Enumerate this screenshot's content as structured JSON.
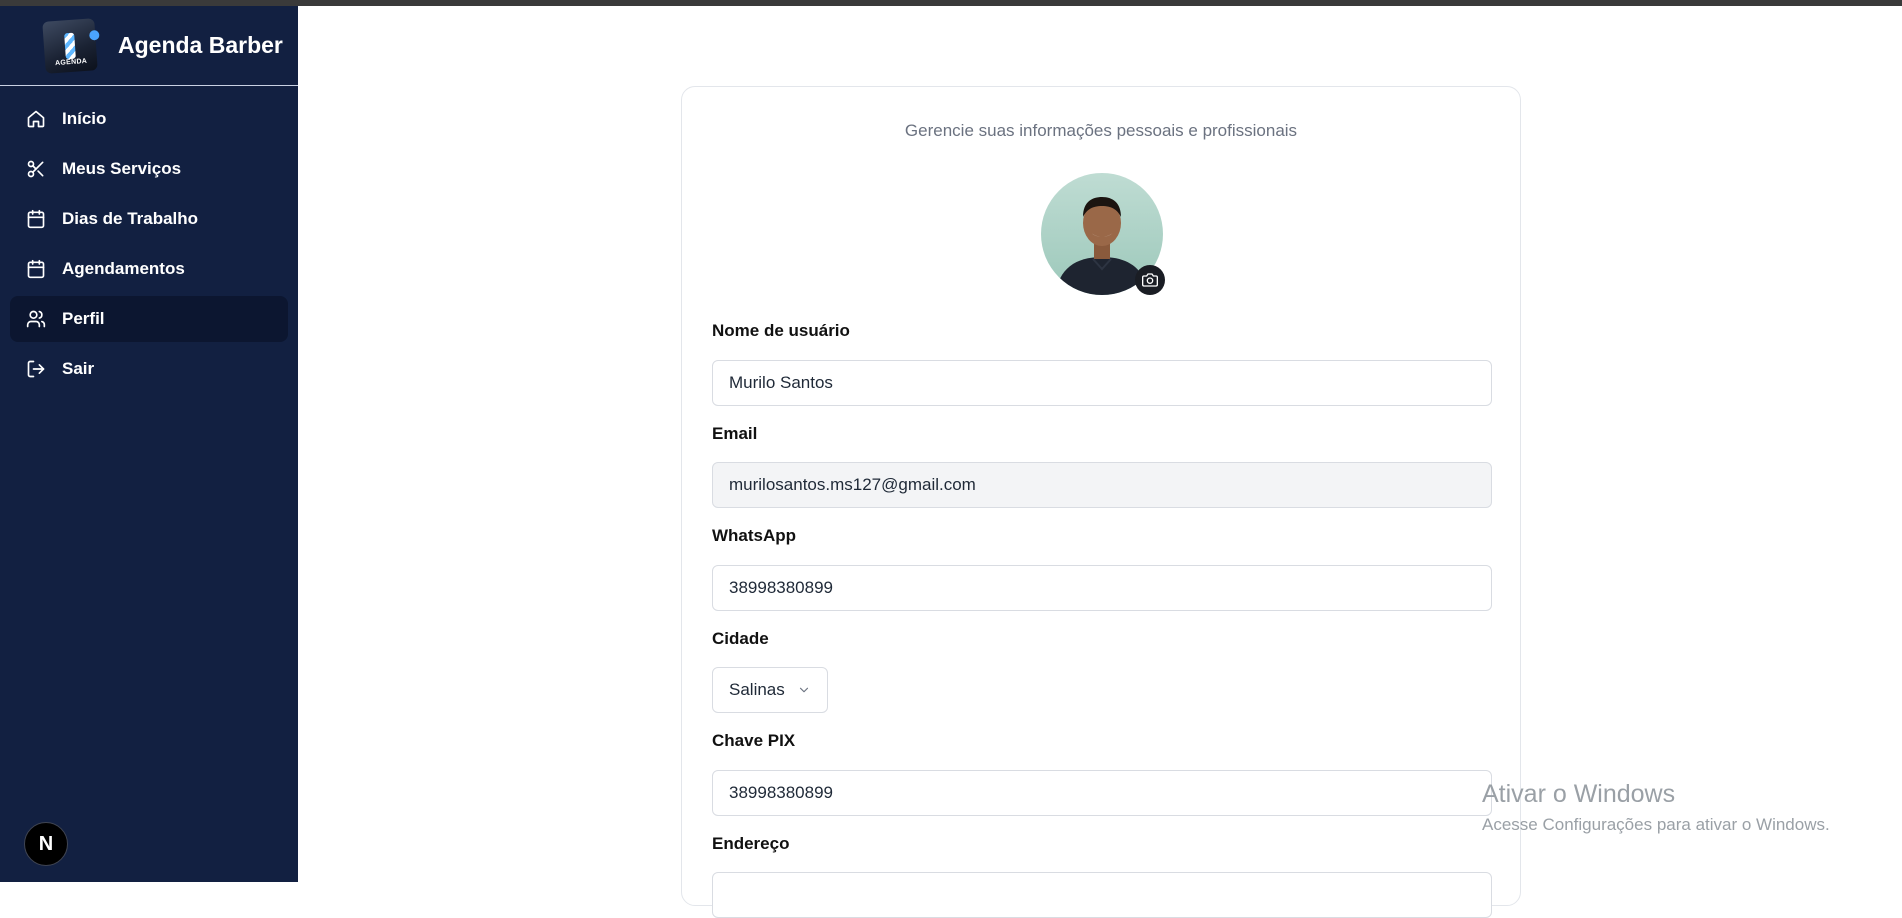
{
  "app": {
    "brand_title": "Agenda Barber",
    "logo_text": "AGENDA"
  },
  "sidebar": {
    "items": [
      {
        "label": "Início",
        "icon": "home-icon"
      },
      {
        "label": "Meus Serviços",
        "icon": "scissors-icon"
      },
      {
        "label": "Dias de Trabalho",
        "icon": "calendar-icon"
      },
      {
        "label": "Agendamentos",
        "icon": "calendar-icon"
      },
      {
        "label": "Perfil",
        "icon": "users-icon",
        "active": true
      },
      {
        "label": "Sair",
        "icon": "logout-icon"
      }
    ],
    "badge": "N"
  },
  "profile": {
    "subtitle": "Gerencie suas informações pessoais e profissionais",
    "fields": {
      "username": {
        "label": "Nome de usuário",
        "value": "Murilo Santos"
      },
      "email": {
        "label": "Email",
        "value": "murilosantos.ms127@gmail.com"
      },
      "whatsapp": {
        "label": "WhatsApp",
        "value": "38998380899"
      },
      "city": {
        "label": "Cidade",
        "value": "Salinas"
      },
      "pix": {
        "label": "Chave PIX",
        "value": "38998380899"
      },
      "address": {
        "label": "Endereço",
        "value": ""
      }
    }
  },
  "watermark": {
    "line1": "Ativar o Windows",
    "line2": "Acesse Configurações para ativar o Windows."
  },
  "colors": {
    "sidebar_bg": "#122041",
    "sidebar_active": "#0c1630",
    "readonly_bg": "#f3f4f6"
  }
}
